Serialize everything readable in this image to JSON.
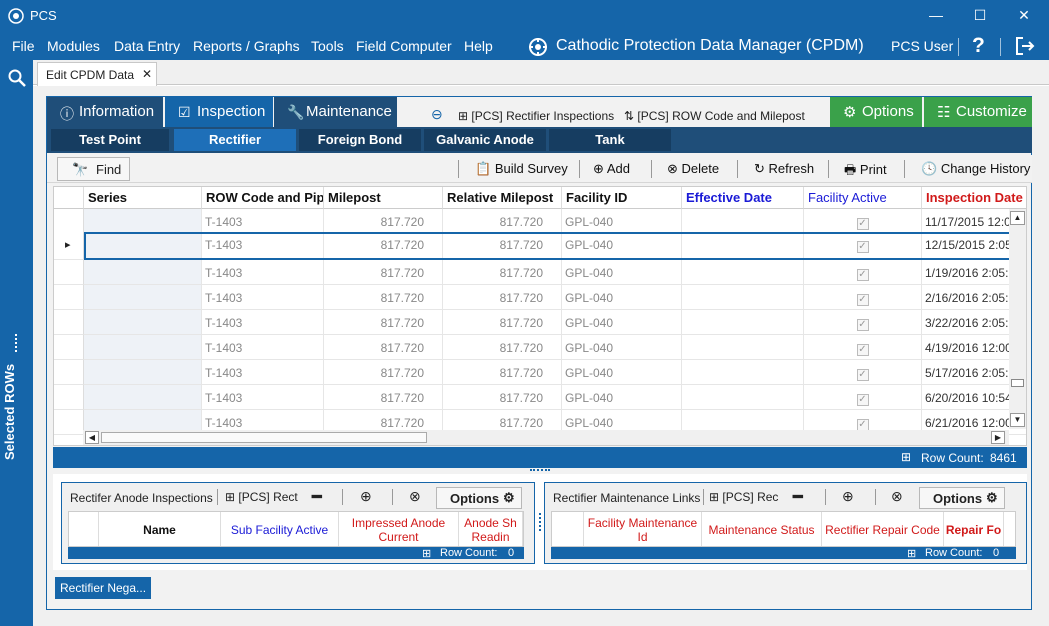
{
  "window": {
    "title": "PCS",
    "minimize": "—",
    "maximize": "☐",
    "close": "✕"
  },
  "menubar": {
    "items": [
      "File",
      "Modules",
      "Data Entry",
      "Reports / Graphs",
      "Tools",
      "Field Computer",
      "Help"
    ],
    "app_title": "Cathodic Protection Data Manager (CPDM)",
    "user": "PCS User",
    "help_glyph": "?",
    "colors": {
      "primary": "#1565a9",
      "green": "#3aa14a"
    }
  },
  "left_rail": {
    "label": "Selected ROWs"
  },
  "doc_tab": {
    "label": "Edit CPDM Data",
    "close": "✕"
  },
  "top_tabs": [
    {
      "label": "Information",
      "icon": "info-icon"
    },
    {
      "label": "Inspection",
      "icon": "checkbox-icon"
    },
    {
      "label": "Maintenance",
      "icon": "wrench-icon"
    }
  ],
  "links": [
    {
      "label": "[PCS] Rectifier Inspections",
      "icon": "grid-icon"
    },
    {
      "label": "[PCS] ROW Code and Milepost",
      "icon": "sort-icon"
    }
  ],
  "right_buttons": {
    "options": "Options",
    "customize": "Customize"
  },
  "sub_tabs": [
    "Test Point",
    "Rectifier",
    "Foreign Bond",
    "Galvanic Anode",
    "Tank"
  ],
  "toolbar": {
    "find": "Find",
    "build_survey": "Build Survey",
    "add": "Add",
    "delete": "Delete",
    "refresh": "Refresh",
    "print": "Print",
    "change_history": "Change History"
  },
  "grid": {
    "columns": [
      "Series",
      "ROW Code and Pipe",
      "Milepost",
      "Relative Milepost",
      "Facility ID",
      "Effective Date",
      "Facility Active",
      "Inspection Date"
    ],
    "column_colors": [
      "#111111",
      "#111111",
      "#111111",
      "#111111",
      "#111111",
      "#1a1ad6",
      "#1a1ad6",
      "#d11a1a"
    ],
    "rows": [
      {
        "series": "",
        "row_code": "T-1403",
        "milepost": "817.720",
        "relative_milepost": "817.720",
        "facility_id": "GPL-040",
        "effective_date": "",
        "active": true,
        "inspection_date": "11/17/2015 12:0"
      },
      {
        "series": "",
        "row_code": "T-1403",
        "milepost": "817.720",
        "relative_milepost": "817.720",
        "facility_id": "GPL-040",
        "effective_date": "",
        "active": true,
        "inspection_date": "12/15/2015 2:05"
      },
      {
        "series": "",
        "row_code": "T-1403",
        "milepost": "817.720",
        "relative_milepost": "817.720",
        "facility_id": "GPL-040",
        "effective_date": "",
        "active": true,
        "inspection_date": "1/19/2016 2:05:"
      },
      {
        "series": "",
        "row_code": "T-1403",
        "milepost": "817.720",
        "relative_milepost": "817.720",
        "facility_id": "GPL-040",
        "effective_date": "",
        "active": true,
        "inspection_date": "2/16/2016 2:05:"
      },
      {
        "series": "",
        "row_code": "T-1403",
        "milepost": "817.720",
        "relative_milepost": "817.720",
        "facility_id": "GPL-040",
        "effective_date": "",
        "active": true,
        "inspection_date": "3/22/2016 2:05:"
      },
      {
        "series": "",
        "row_code": "T-1403",
        "milepost": "817.720",
        "relative_milepost": "817.720",
        "facility_id": "GPL-040",
        "effective_date": "",
        "active": true,
        "inspection_date": "4/19/2016 12:00"
      },
      {
        "series": "",
        "row_code": "T-1403",
        "milepost": "817.720",
        "relative_milepost": "817.720",
        "facility_id": "GPL-040",
        "effective_date": "",
        "active": true,
        "inspection_date": "5/17/2016 2:05:"
      },
      {
        "series": "",
        "row_code": "T-1403",
        "milepost": "817.720",
        "relative_milepost": "817.720",
        "facility_id": "GPL-040",
        "effective_date": "",
        "active": true,
        "inspection_date": "6/20/2016 10:54"
      },
      {
        "series": "",
        "row_code": "T-1403",
        "milepost": "817.720",
        "relative_milepost": "817.720",
        "facility_id": "GPL-040",
        "effective_date": "",
        "active": true,
        "inspection_date": "6/21/2016 12:00"
      }
    ],
    "selected_row": 1,
    "row_count_label": "Row Count:",
    "row_count": "8461"
  },
  "panel_left": {
    "title": "Rectifer Anode Inspections",
    "link": "[PCS] Rect",
    "options": "Options",
    "columns": [
      "Name",
      "Sub Facility Active",
      "Impressed Anode Current",
      "Anode Sh Readin"
    ],
    "column_colors": [
      "#111111",
      "#1a1ad6",
      "#d11a1a",
      "#d11a1a"
    ],
    "row_count_label": "Row Count:",
    "row_count": "0"
  },
  "panel_right": {
    "title": "Rectifier Maintenance Links",
    "link": "[PCS] Rec",
    "options": "Options",
    "columns": [
      "Facility Maintenance Id",
      "Maintenance Status",
      "Rectifier Repair Code",
      "Repair Fo"
    ],
    "column_colors": [
      "#d11a1a",
      "#d11a1a",
      "#d11a1a",
      "#d11a1a"
    ],
    "row_count_label": "Row Count:",
    "row_count": "0"
  },
  "bottom_button": {
    "label": "Rectifier Nega..."
  }
}
